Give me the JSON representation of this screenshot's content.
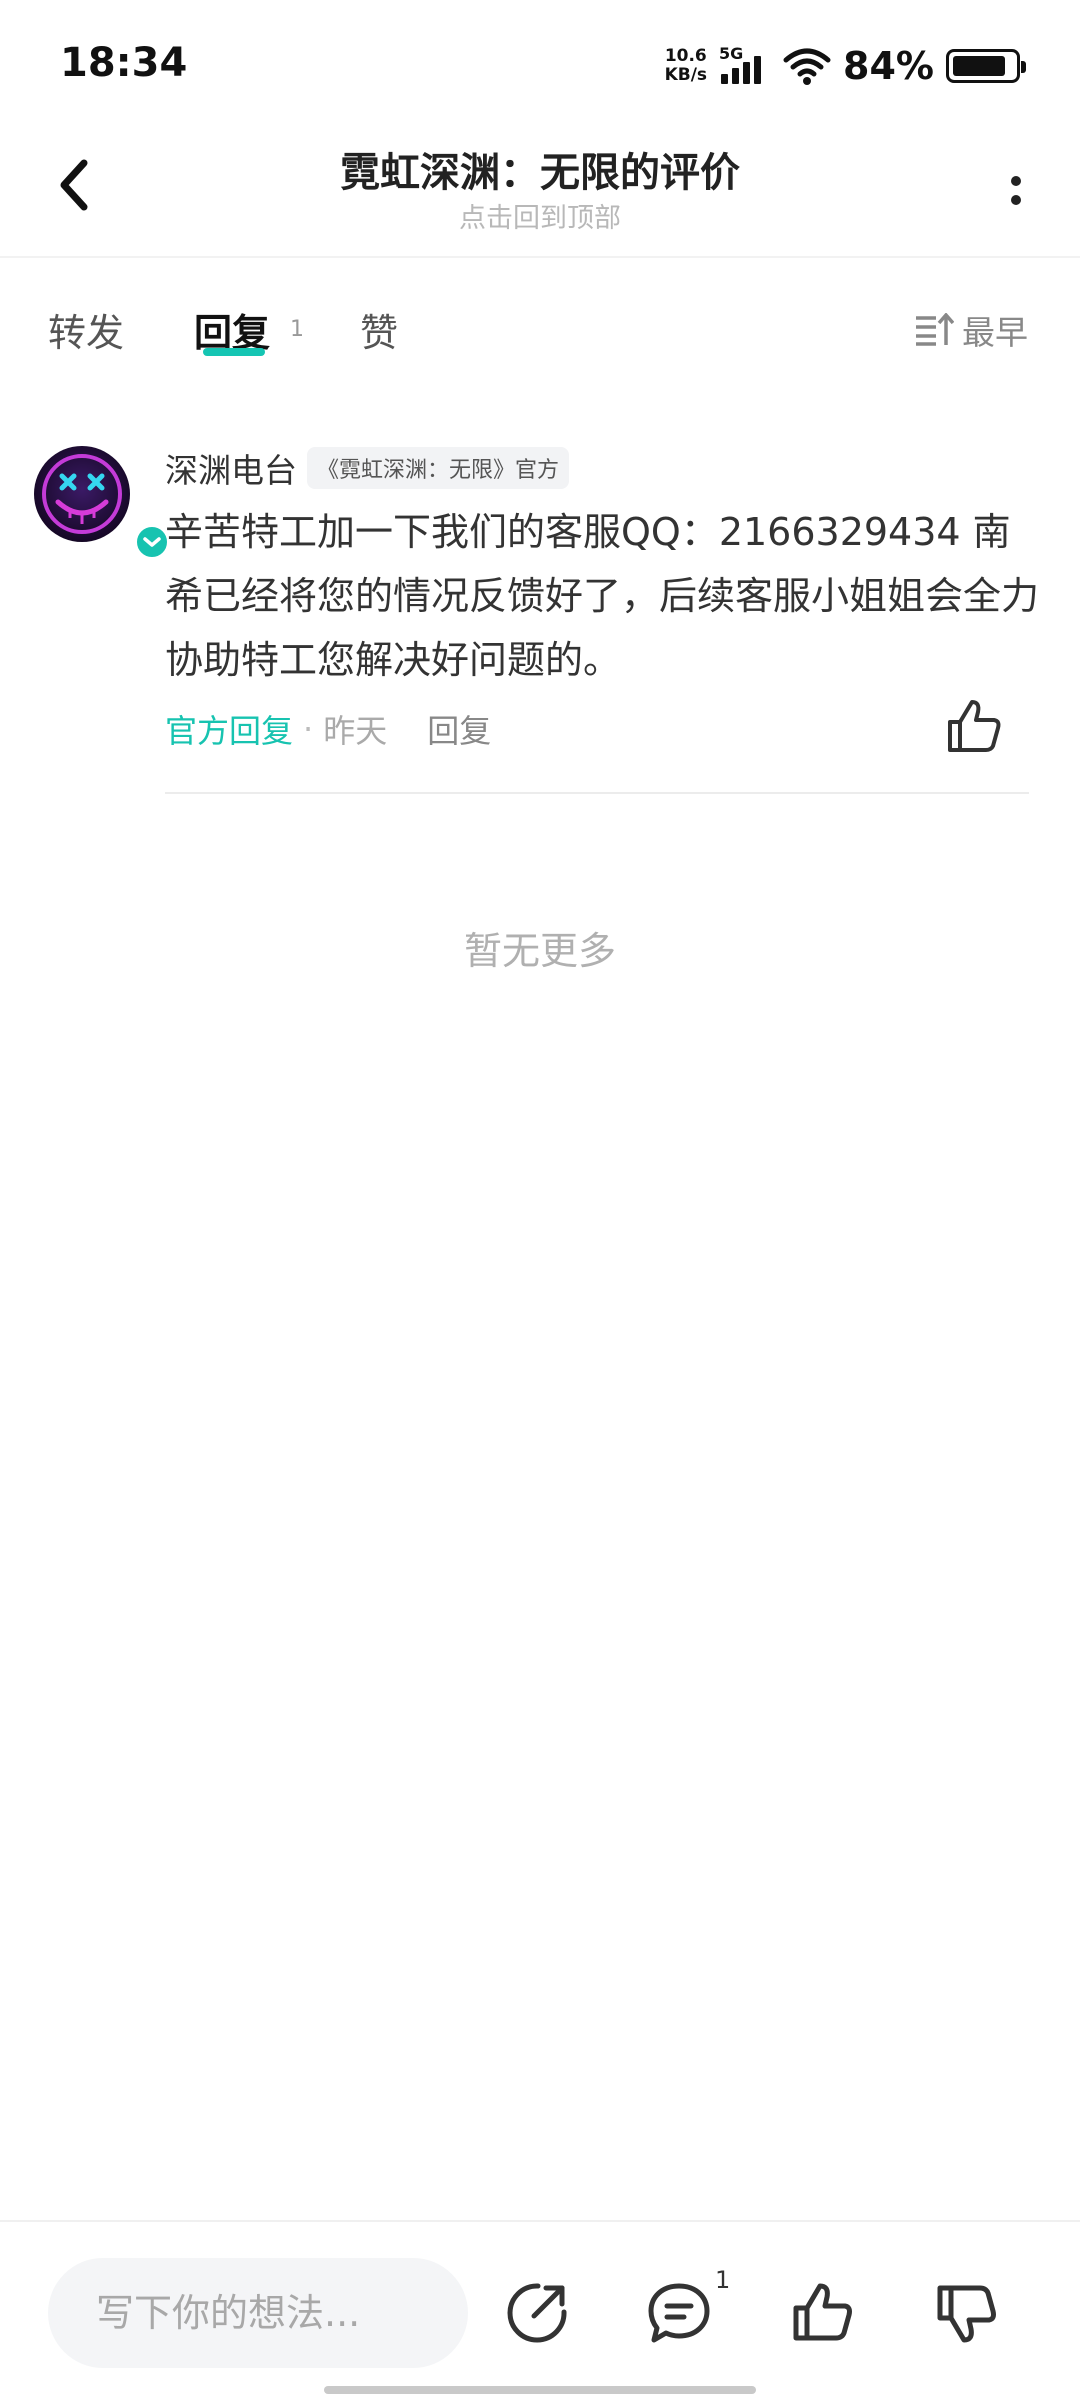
{
  "status_bar": {
    "time": "18:34",
    "net_speed_value": "10.6",
    "net_speed_unit": "KB/s",
    "network_type": "5G",
    "battery_percent": "84%"
  },
  "header": {
    "title": "霓虹深渊：无限的评价",
    "subtitle": "点击回到顶部"
  },
  "tabs": [
    {
      "label": "转发",
      "active": false
    },
    {
      "label": "回复",
      "count": "1",
      "active": true
    },
    {
      "label": "赞",
      "active": false
    }
  ],
  "sort": {
    "label": "最早"
  },
  "comment": {
    "author": "深渊电台",
    "author_tag": "《霓虹深渊：无限》官方",
    "text": "辛苦特工加一下我们的客服QQ：2166329434 南希已经将您的情况反馈好了，后续客服小姐姐会全力协助特工您解决好问题的。",
    "official_label": "官方回复",
    "dot": "·",
    "time": "昨天",
    "reply_label": "回复"
  },
  "empty_state": "暂无更多",
  "bottom_bar": {
    "input_placeholder": "写下你的想法...",
    "comments_count": "1"
  },
  "colors": {
    "accent": "#17c3b0",
    "text_primary": "#333333",
    "text_muted": "#aaaaaa"
  }
}
